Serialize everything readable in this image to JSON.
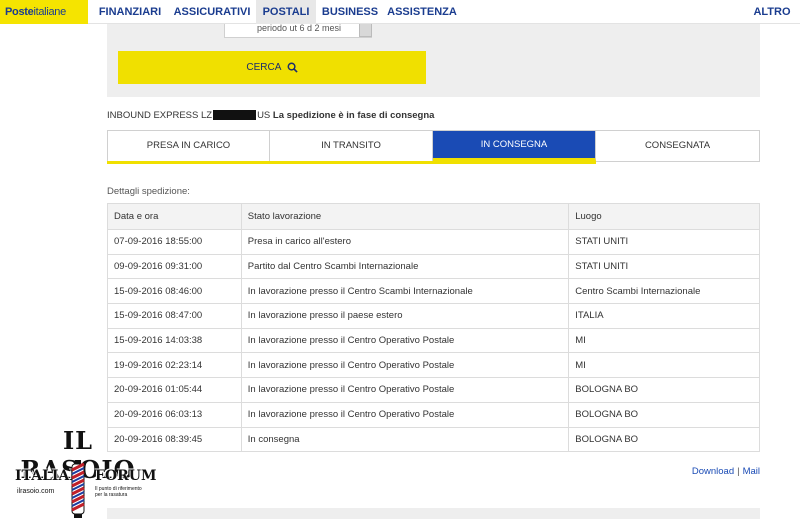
{
  "nav": {
    "logo_bold": "Poste",
    "logo_rest": "italiane",
    "items": [
      "FINANZIARI",
      "ASSICURATIVI",
      "POSTALI",
      "BUSINESS",
      "ASSISTENZA"
    ],
    "active": "POSTALI",
    "altro": "ALTRO"
  },
  "search": {
    "periodo_text": "periodo ut 6 d 2 mesi",
    "cerca_label": "CERCA"
  },
  "shipment": {
    "prefix": "INBOUND EXPRESS LZ",
    "suffix": "US",
    "status_message": "La spedizione è in fase di consegna"
  },
  "steps": [
    {
      "label": "PRESA IN CARICO",
      "active": false
    },
    {
      "label": "IN TRANSITO",
      "active": false
    },
    {
      "label": "IN CONSEGNA",
      "active": true
    },
    {
      "label": "CONSEGNATA",
      "active": false
    }
  ],
  "details": {
    "title": "Dettagli spedizione:",
    "columns": [
      "Data e ora",
      "Stato lavorazione",
      "Luogo"
    ],
    "rows": [
      [
        "07-09-2016 18:55:00",
        "Presa in carico all'estero",
        "STATI UNITI"
      ],
      [
        "09-09-2016 09:31:00",
        "Partito dal Centro Scambi Internazionale",
        "STATI UNITI"
      ],
      [
        "15-09-2016 08:46:00",
        "In lavorazione presso il Centro Scambi Internazionale",
        "Centro Scambi Internazionale"
      ],
      [
        "15-09-2016 08:47:00",
        "In lavorazione presso il paese estero",
        "ITALIA"
      ],
      [
        "15-09-2016 14:03:38",
        "In lavorazione presso il Centro Operativo Postale",
        "MI"
      ],
      [
        "19-09-2016 02:23:14",
        "In lavorazione presso il Centro Operativo Postale",
        "MI"
      ],
      [
        "20-09-2016 01:05:44",
        "In lavorazione presso il Centro Operativo Postale",
        "BOLOGNA BO"
      ],
      [
        "20-09-2016 06:03:13",
        "In lavorazione presso il Centro Operativo Postale",
        "BOLOGNA BO"
      ],
      [
        "20-09-2016 08:39:45",
        "In consegna",
        "BOLOGNA BO"
      ]
    ]
  },
  "links": {
    "download": "Download",
    "separator": "|",
    "mail": "Mail"
  },
  "watermark": {
    "title": "IL RASOIO",
    "left": "ITALIAN",
    "right": "FORUM",
    "site": "ilrasoio.com",
    "sub": "Il punto di riferimento per la rasatura"
  },
  "colors": {
    "yellow": "#f0e000",
    "blue": "#1a4bb5",
    "nav_text": "#1a3c8f"
  }
}
